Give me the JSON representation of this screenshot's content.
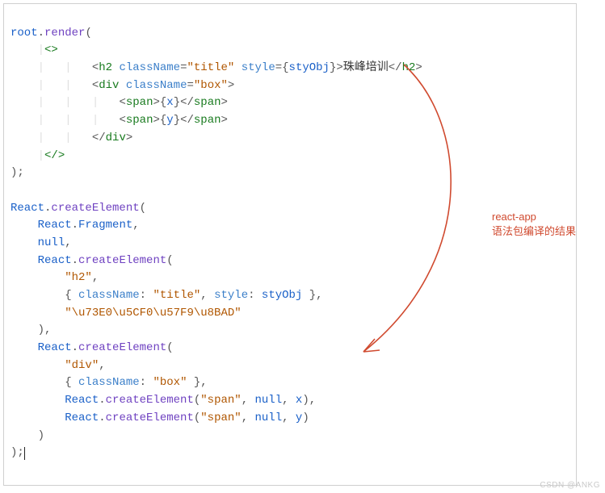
{
  "code": {
    "l01_root": "root",
    "l01_dot": ".",
    "l01_render": "render",
    "l01_openParen": "(",
    "l02_fragOpen": "<>",
    "l03_openH2": "<",
    "l03_h2": "h2",
    "l03_sp1": " ",
    "l03_className": "className",
    "l03_eq1": "=",
    "l03_classVal": "\"title\"",
    "l03_sp2": " ",
    "l03_style": "style",
    "l03_eq2": "=",
    "l03_braceOpen": "{",
    "l03_styObj": "styObj",
    "l03_braceClose": "}",
    "l03_gt": ">",
    "l03_text": "珠峰培训",
    "l03_closeH2o": "</",
    "l03_closeH2t": "h2",
    "l03_closeH2c": ">",
    "l04_openDiv": "<",
    "l04_div": "div",
    "l04_sp": " ",
    "l04_className": "className",
    "l04_eq": "=",
    "l04_classVal": "\"box\"",
    "l04_gt": ">",
    "l05_openSpan": "<",
    "l05_span": "span",
    "l05_gt": ">",
    "l05_bOpen": "{",
    "l05_x": "x",
    "l05_bClose": "}",
    "l05_cOpen": "</",
    "l05_cSpan": "span",
    "l05_cClose": ">",
    "l06_openSpan": "<",
    "l06_span": "span",
    "l06_gt": ">",
    "l06_bOpen": "{",
    "l06_y": "y",
    "l06_bClose": "}",
    "l06_cOpen": "</",
    "l06_cSpan": "span",
    "l06_cClose": ">",
    "l07_closeDivO": "</",
    "l07_closeDiv": "div",
    "l07_closeDivC": ">",
    "l08_fragClose": "</>",
    "l09_closeParen": ")",
    "l09_semi": ";",
    "l11_React": "React",
    "l11_dot": ".",
    "l11_createElement": "createElement",
    "l11_open": "(",
    "l12_React": "React",
    "l12_dot": ".",
    "l12_Fragment": "Fragment",
    "l12_comma": ",",
    "l13_null": "null",
    "l13_comma": ",",
    "l14_React": "React",
    "l14_dot": ".",
    "l14_createElement": "createElement",
    "l14_open": "(",
    "l15_h2str": "\"h2\"",
    "l15_comma": ",",
    "l16_braceOpen": "{ ",
    "l16_className": "className",
    "l16_colon1": ": ",
    "l16_title": "\"title\"",
    "l16_comma1": ", ",
    "l16_style": "style",
    "l16_colon2": ": ",
    "l16_styObj": "styObj",
    "l16_braceClose": " }",
    "l16_comma": ",",
    "l17_unicode": "\"\\u73E0\\u5CF0\\u57F9\\u8BAD\"",
    "l18_close": ")",
    "l18_comma": ",",
    "l19_React": "React",
    "l19_dot": ".",
    "l19_createElement": "createElement",
    "l19_open": "(",
    "l20_divstr": "\"div\"",
    "l20_comma": ",",
    "l21_braceOpen": "{ ",
    "l21_className": "className",
    "l21_colon": ": ",
    "l21_box": "\"box\"",
    "l21_braceClose": " }",
    "l21_comma": ",",
    "l22_React": "React",
    "l22_dot": ".",
    "l22_createElement": "createElement",
    "l22_open": "(",
    "l22_span": "\"span\"",
    "l22_c1": ", ",
    "l22_null": "null",
    "l22_c2": ", ",
    "l22_x": "x",
    "l22_close": ")",
    "l22_comma": ",",
    "l23_React": "React",
    "l23_dot": ".",
    "l23_createElement": "createElement",
    "l23_open": "(",
    "l23_span": "\"span\"",
    "l23_c1": ", ",
    "l23_null": "null",
    "l23_c2": ", ",
    "l23_y": "y",
    "l23_close": ")",
    "l24_close": ")",
    "l25_close": ")",
    "l25_semi": ";"
  },
  "annotation": {
    "line1": "react-app",
    "line2": "语法包编译的结果"
  },
  "watermark": "CSDN @ANKG",
  "colors": {
    "arrow": "#d04a2f"
  }
}
